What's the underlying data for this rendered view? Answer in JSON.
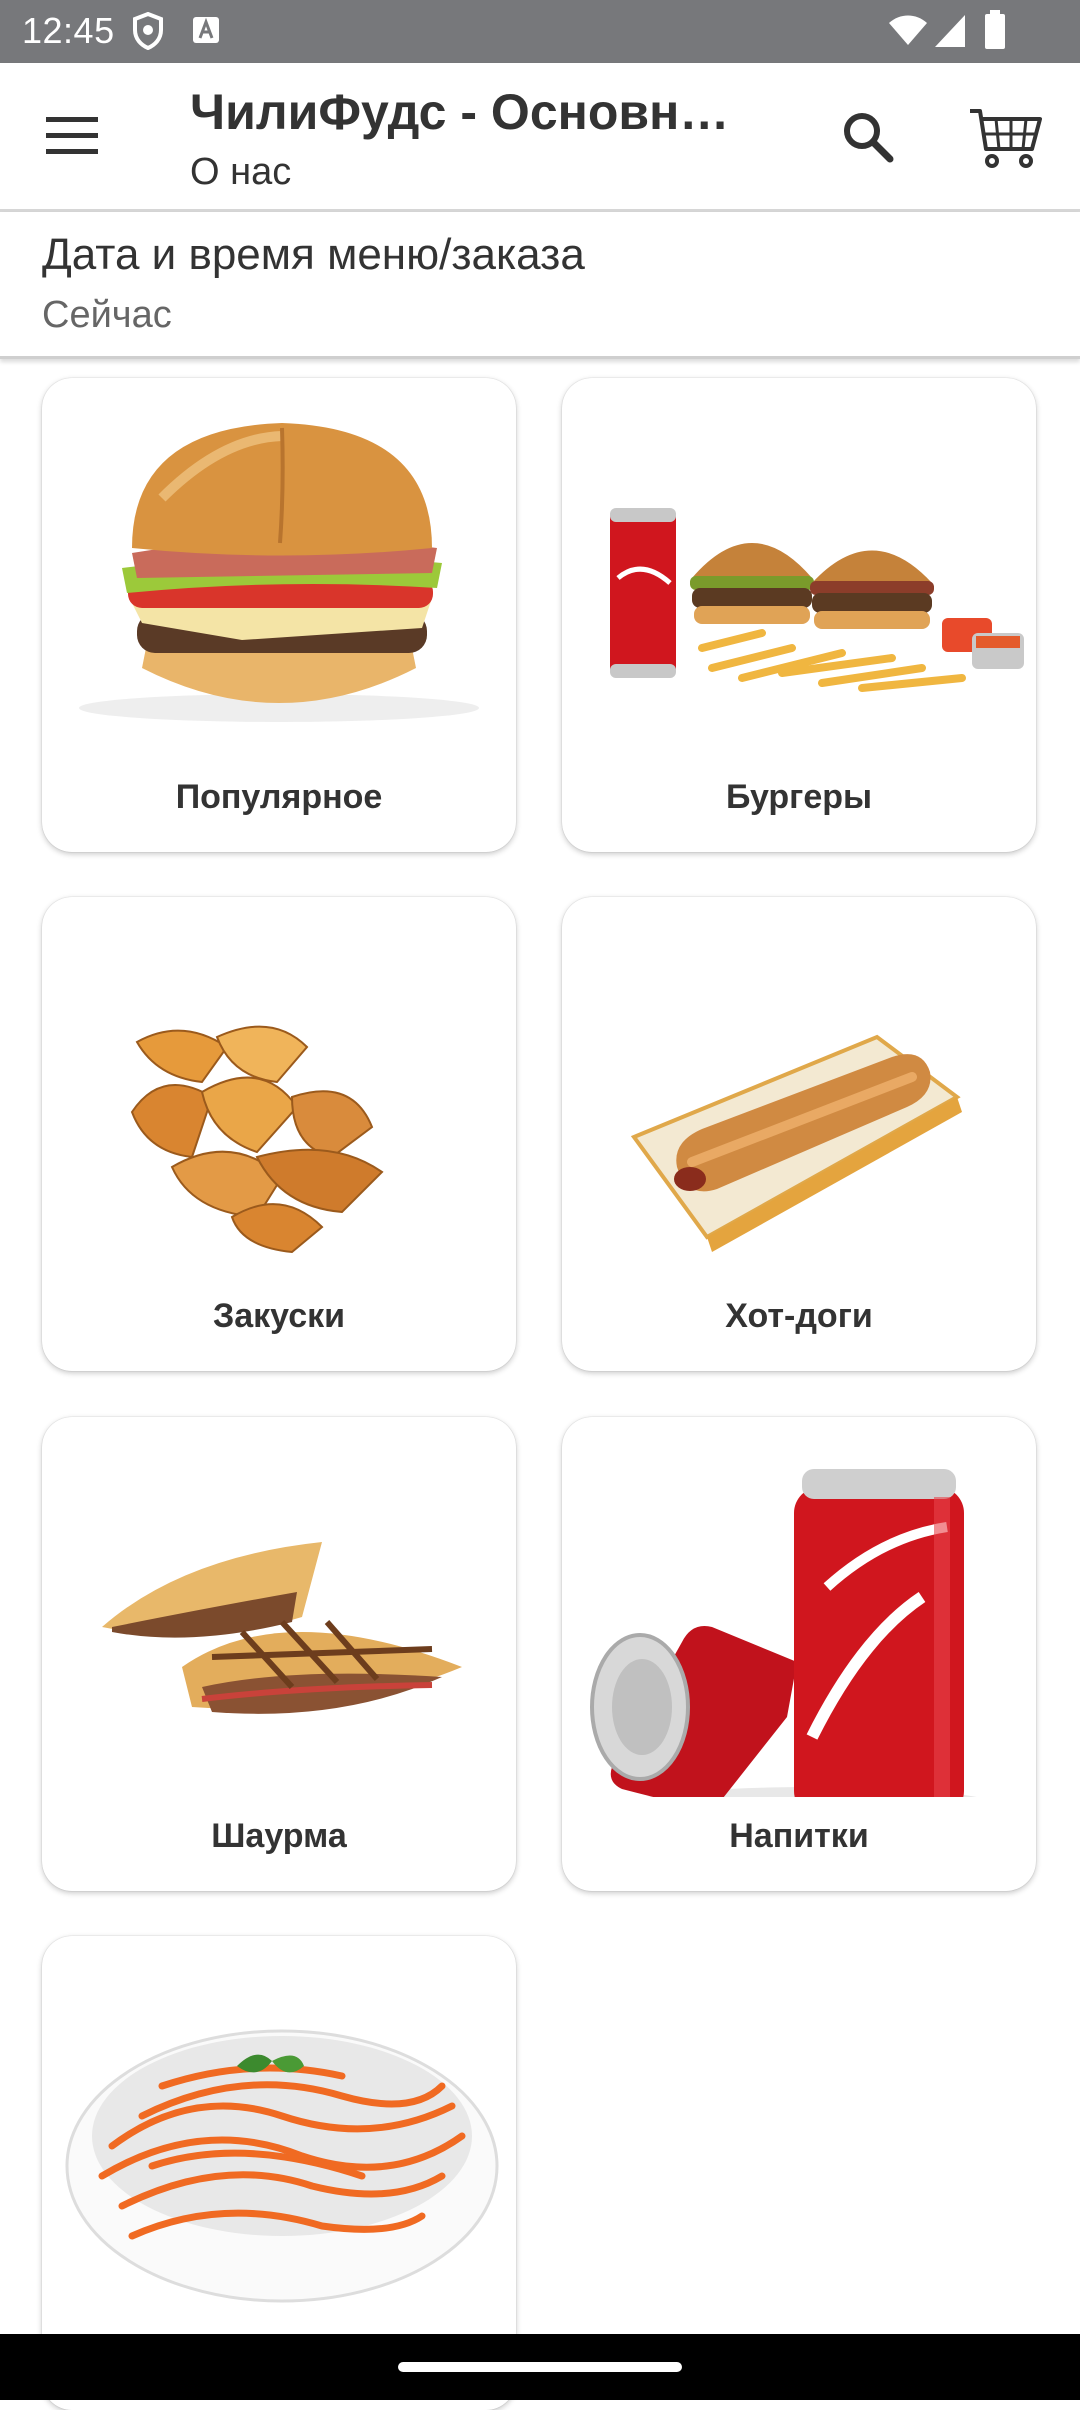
{
  "status_bar": {
    "time": "12:45"
  },
  "app_bar": {
    "title": "ЧилиФудс - Основн…",
    "subtitle": "О нас",
    "icons": {
      "menu": "hamburger-menu-icon",
      "search": "search-icon",
      "cart": "cart-icon"
    }
  },
  "order_time": {
    "label": "Дата и время меню/заказа",
    "value": "Сейчас"
  },
  "categories": [
    {
      "name": "Популярное"
    },
    {
      "name": "Бургеры"
    },
    {
      "name": "Закуски"
    },
    {
      "name": "Хот-доги"
    },
    {
      "name": "Шаурма"
    },
    {
      "name": "Напитки"
    },
    {
      "name": ""
    }
  ],
  "colors": {
    "status_bar": "#77787b",
    "cola_red": "#d0161e"
  }
}
